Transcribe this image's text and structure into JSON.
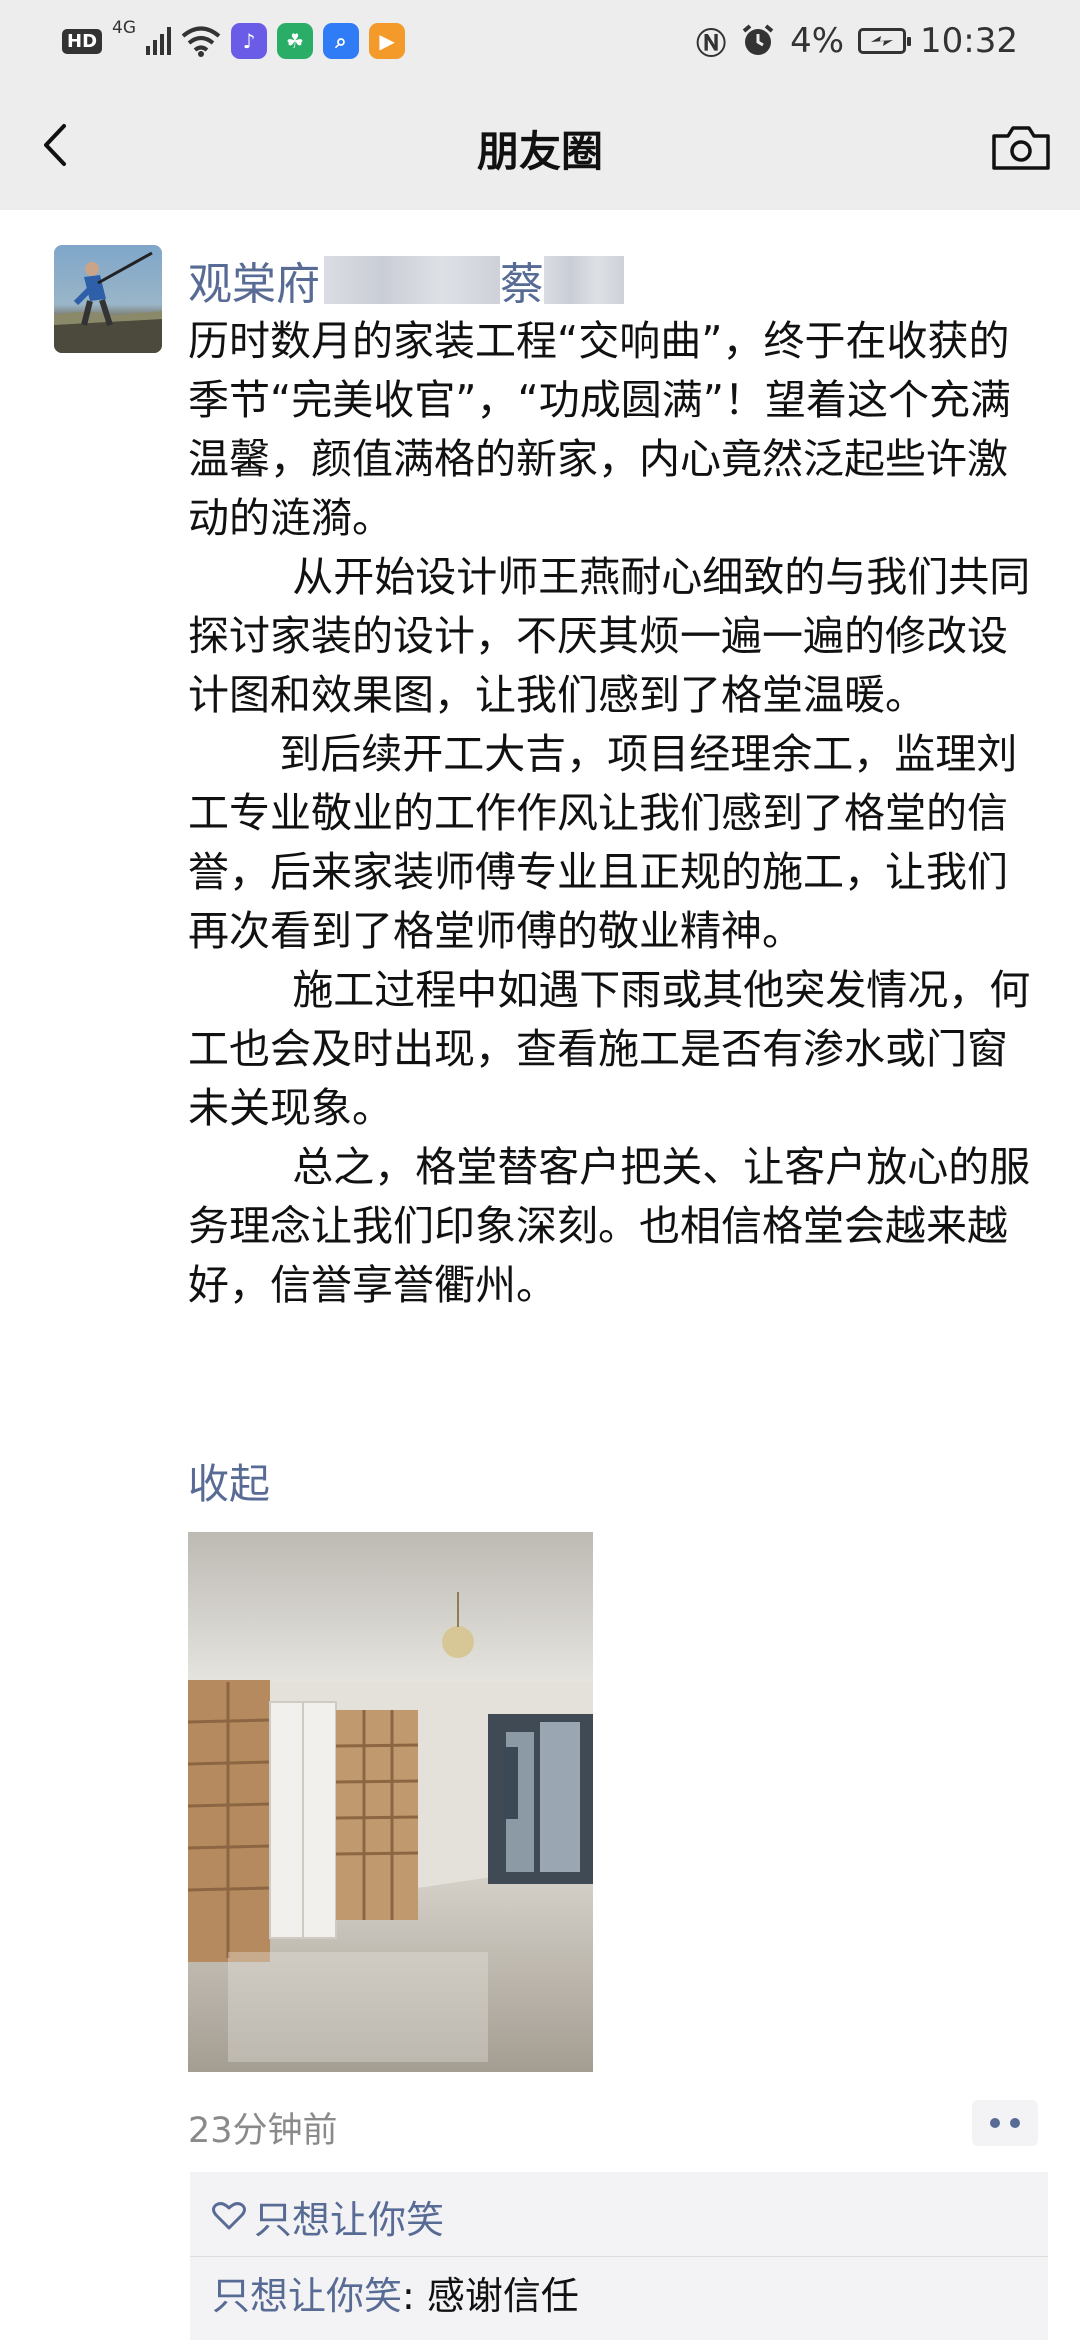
{
  "status_bar": {
    "network_badge": "HD",
    "network_type": "4G",
    "battery_text": "4%",
    "time": "10:32"
  },
  "nav": {
    "title": "朋友圈"
  },
  "post": {
    "author": "观棠府蔡",
    "author_parts": [
      "观棠府",
      "蔡"
    ],
    "paragraphs": [
      "历时数月的家装工程“交响曲”，终于在收获的季节“完美收官”，“功成圆满”！望着这个充满温馨，颜值满格的新家，内心竟然泛起些许激动的涟漪。",
      "        从开始设计师王燕耐心细致的与我们共同探讨家装的设计，不厌其烦一遍一遍的修改设计图和效果图，让我们感到了格堂温暖。",
      "       到后续开工大吉，项目经理余工，监理刘工专业敬业的工作作风让我们感到了格堂的信誉，后来家装师傅专业且正规的施工，让我们再次看到了格堂师傅的敬业精神。",
      "        施工过程中如遇下雨或其他突发情况，何工也会及时出现，查看施工是否有渗水或门窗未关现象。",
      "        总之，格堂替客户把关、让客户放心的服务理念让我们印象深刻。也相信格堂会越来越好，信誉享誉衢州。"
    ],
    "collapse_label": "收起",
    "time_ago": "23分钟前",
    "likes": "只想让你笑",
    "comment": {
      "author": "只想让你笑",
      "separator": ": ",
      "text": "感谢信任"
    }
  },
  "colors": {
    "link_blue": "#576b95",
    "nav_bg": "#ededed",
    "interact_bg": "#f3f3f5"
  }
}
